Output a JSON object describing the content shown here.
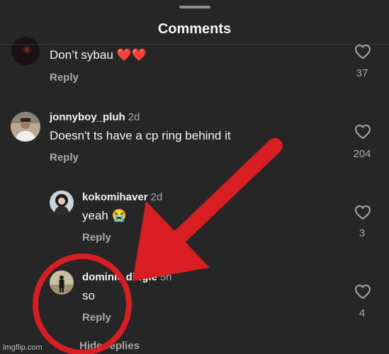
{
  "sheet": {
    "title": "Comments"
  },
  "comments": [
    {
      "username": "",
      "time": "",
      "text": "Don’t sybau ❤️❤️",
      "reply": "Reply",
      "likes": "37",
      "avatar": "dark-avatar"
    },
    {
      "username": "jonnyboy_pluh",
      "time": "2d",
      "text": "Doesn't ts have a cp ring behind it",
      "reply": "Reply",
      "likes": "204",
      "avatar": "man-avatar"
    },
    {
      "username": "kokomihaver",
      "time": "2d",
      "text": "yeah 😭",
      "reply": "Reply",
      "likes": "3",
      "avatar": "girl-avatar"
    },
    {
      "username": "dominic.dingle",
      "time": "5h",
      "text": "so",
      "reply": "Reply",
      "likes": "4",
      "avatar": "figure-avatar"
    }
  ],
  "footer": {
    "hide_replies": "Hide replies"
  },
  "watermark": "imgflip.com",
  "annotation": {
    "color": "#d81e23",
    "arrow": "red-arrow",
    "circle": "red-circle"
  }
}
